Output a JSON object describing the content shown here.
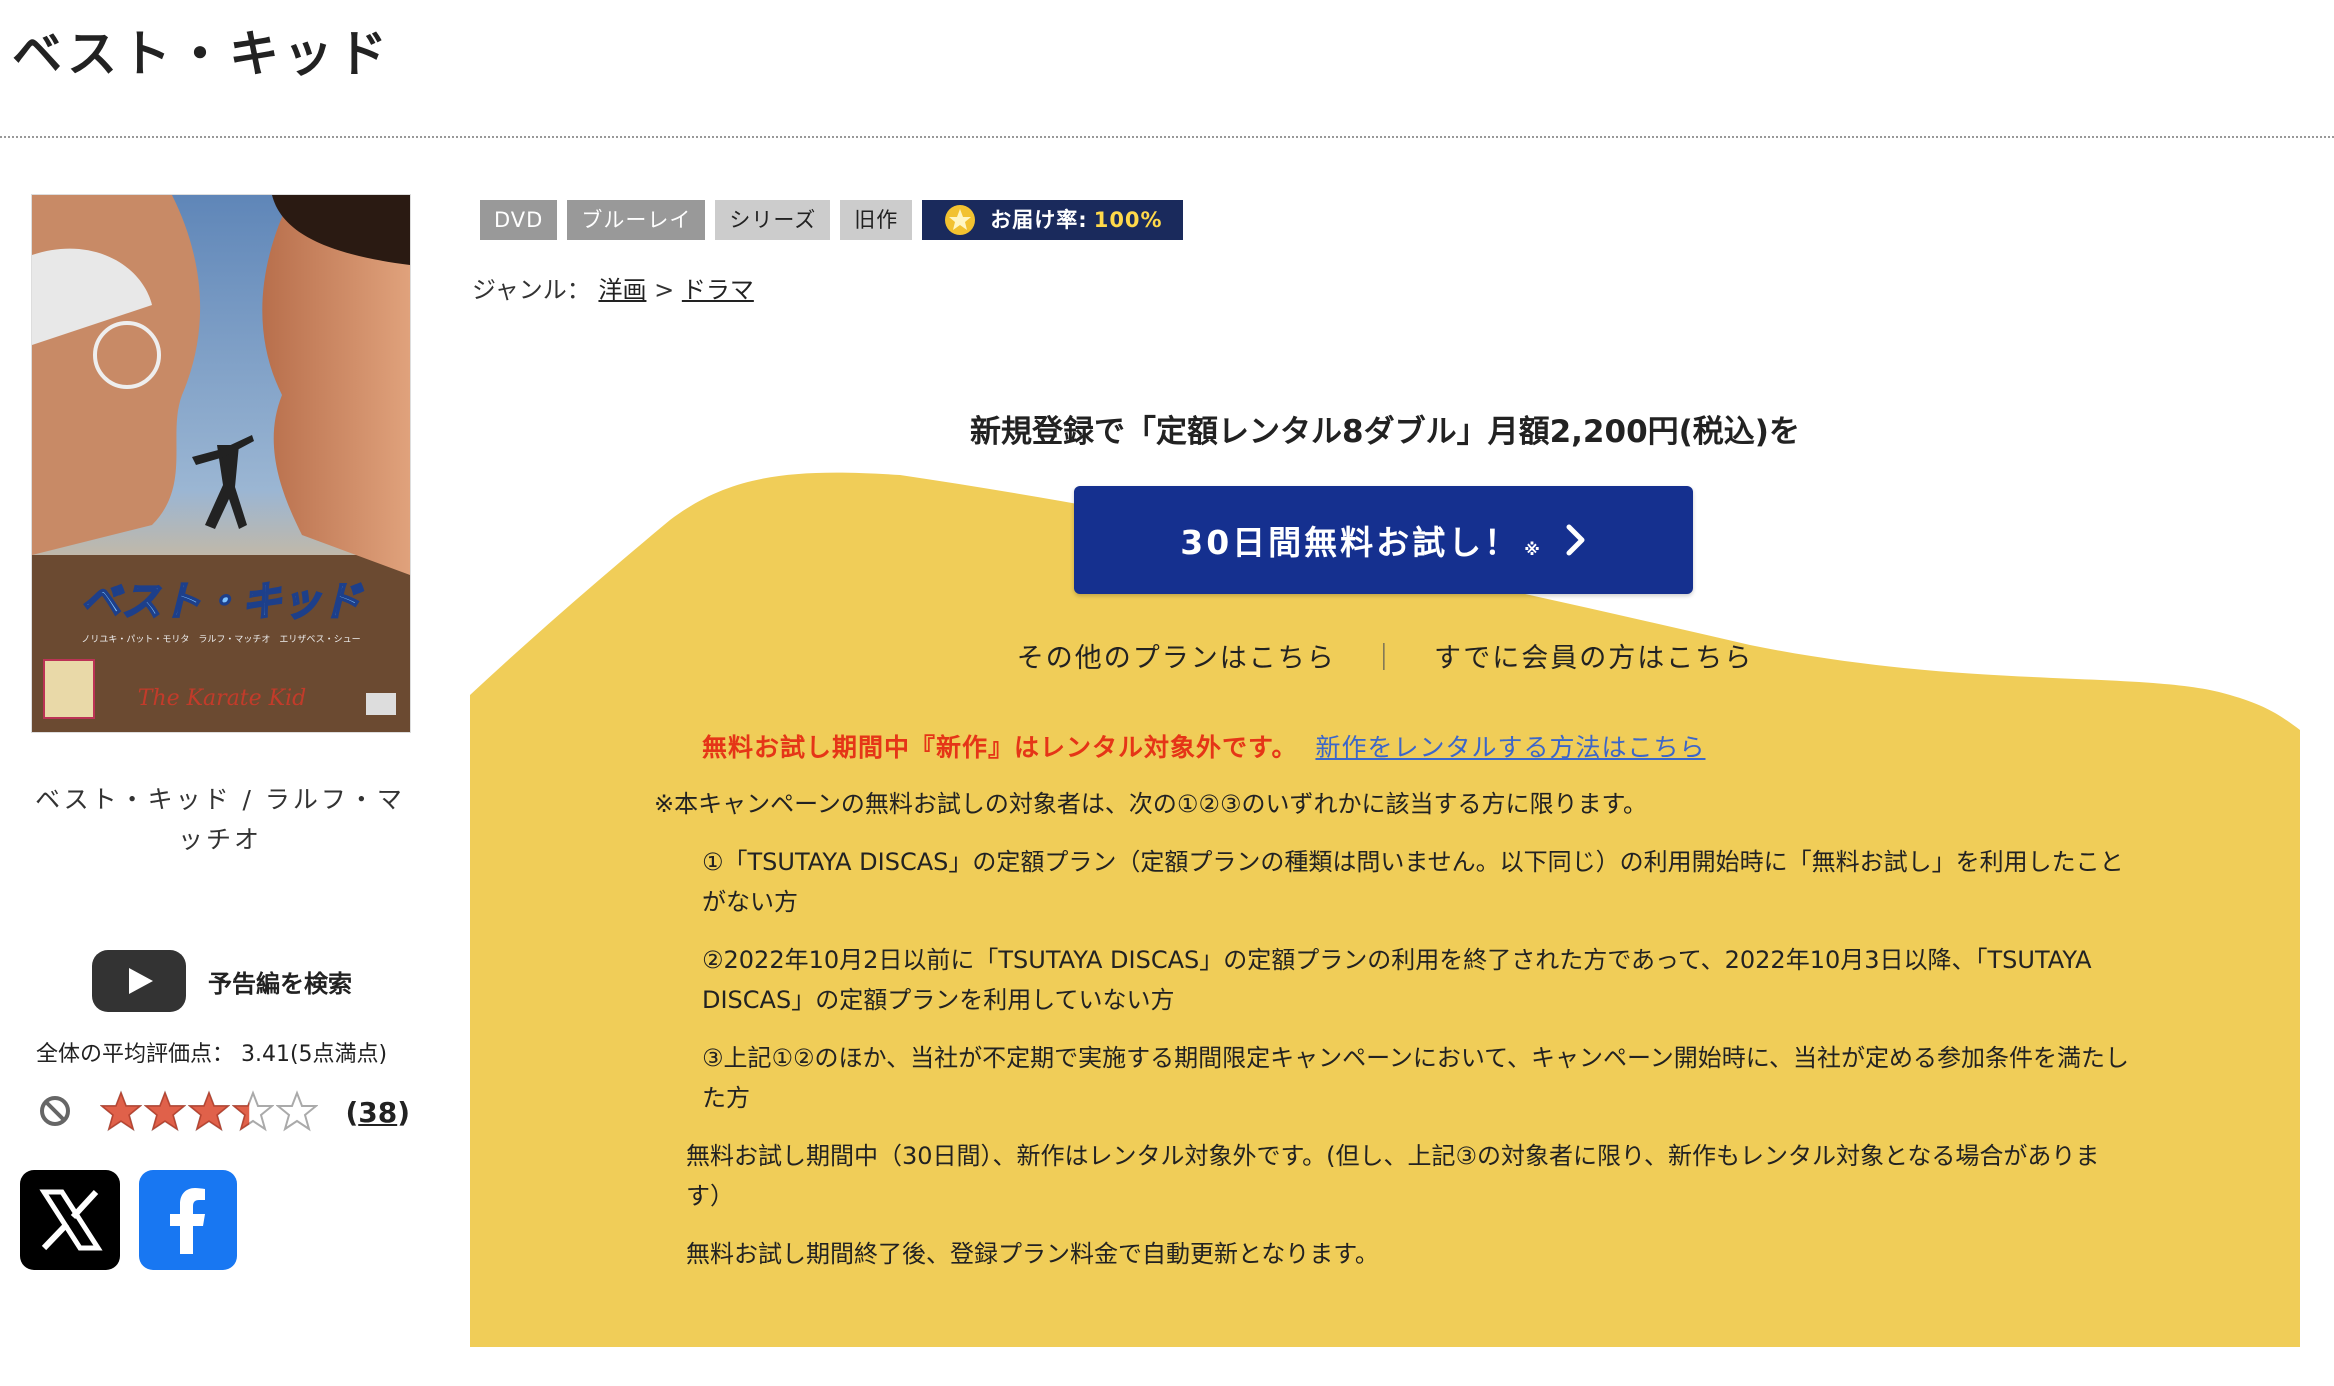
{
  "page": {
    "title": "ベスト・キッド"
  },
  "poster": {
    "art_title": "ベスト・キッド",
    "art_sub": "ノリユキ・パット・モリタ　ラルフ・マッチオ　エリザベス・シュー",
    "caption": "ベスト・キッド / ラルフ・マッチオ"
  },
  "trailer": {
    "label": "予告編を検索",
    "icon": "youtube-play-icon"
  },
  "rating": {
    "average_text": "全体の平均評価点： 3.41(5点満点)",
    "value": 3.41,
    "max": 5,
    "count": "38",
    "count_open": "(",
    "count_close": ")"
  },
  "social": {
    "x_icon": "x-logo-icon",
    "facebook_icon": "facebook-logo-icon"
  },
  "badges": [
    {
      "label": "DVD"
    },
    {
      "label": "ブルーレイ"
    },
    {
      "label": "シリーズ"
    },
    {
      "label": "旧作"
    }
  ],
  "delivery": {
    "label": "お届け率:",
    "value": "100%"
  },
  "genre": {
    "label": "ジャンル：",
    "parent": "洋画",
    "sep": ">",
    "child": "ドラマ"
  },
  "campaign": {
    "headline": "新規登録で「定額レンタル8ダブル」月額2,200円(税込)を",
    "cta_label": "30日間無料お試し！",
    "cta_mark": "※",
    "other_plans": "その他のプランはこちら",
    "separator": "｜",
    "member_link": "すでに会員の方はこちら",
    "notice_red": "無料お試し期間中『新作』はレンタル対象外です。",
    "notice_link": "新作をレンタルする方法はこちら",
    "terms_intro": "※本キャンペーンの無料お試しの対象者は、次の①②③のいずれかに該当する方に限ります。",
    "terms_items": [
      "①「TSUTAYA DISCAS」の定額プラン（定額プランの種類は問いません。以下同じ）の利用開始時に「無料お試し」を利用したことがない方",
      "②2022年10月2日以前に「TSUTAYA DISCAS」の定額プランの利用を終了された方であって、2022年10月3日以降、「TSUTAYA DISCAS」の定額プランを利用していない方",
      "③上記①②のほか、当社が不定期で実施する期間限定キャンペーンにおいて、キャンペーン開始時に、当社が定める参加条件を満たした方"
    ],
    "terms_after": [
      "無料お試し期間中（30日間）、新作はレンタル対象外です。(但し、上記③の対象者に限り、新作もレンタル対象となる場合があります）",
      "無料お試し期間終了後、登録プラン料金で自動更新となります。"
    ]
  },
  "colors": {
    "cta": "#15308f",
    "campaign_bg": "#f0cd58",
    "notice_red": "#e53517",
    "link_blue": "#3c66c9",
    "badge_dark": "#1a2a5c"
  }
}
